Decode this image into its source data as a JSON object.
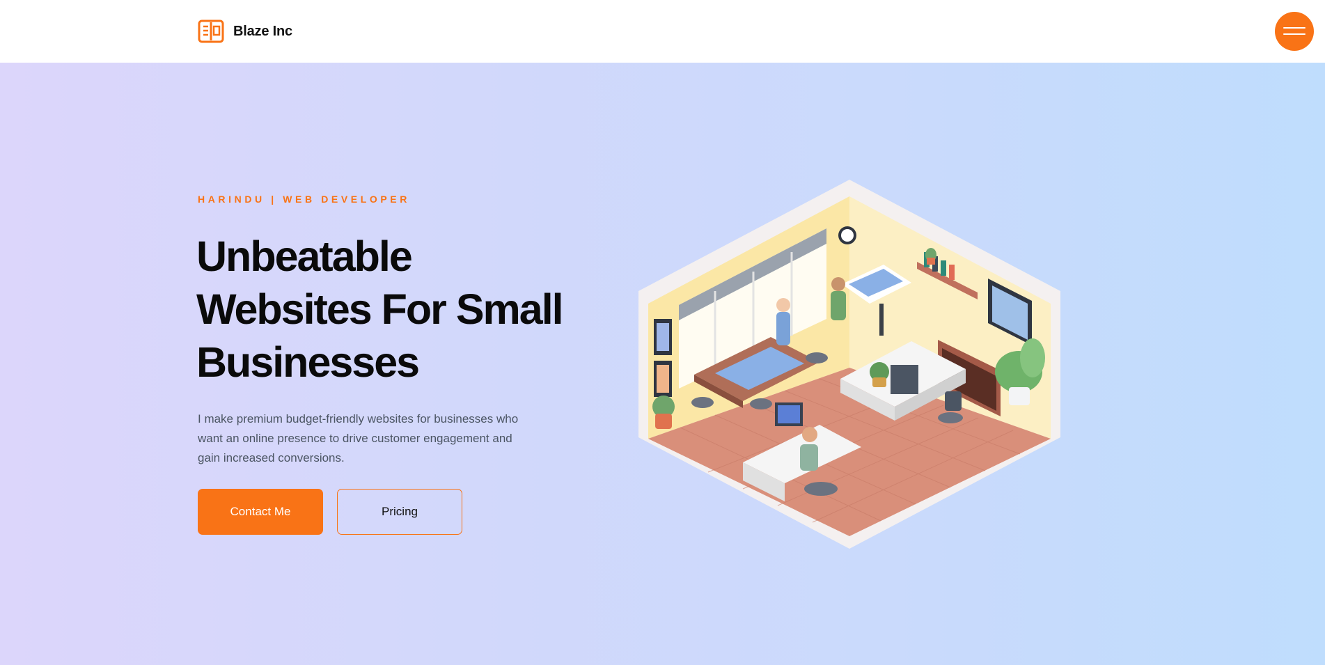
{
  "header": {
    "brand_name": "Blaze Inc",
    "logo_icon": "book-logo-icon",
    "menu_icon": "hamburger-menu-icon"
  },
  "hero": {
    "eyebrow": "HARINDU | WEB DEVELOPER",
    "headline_lines": [
      "Unbeatable",
      "Websites For Small",
      "Businesses"
    ],
    "description_lines": [
      "I make premium budget-friendly websites for businesses who",
      "want an online presence to drive customer engagement and",
      "gain increased conversions."
    ],
    "primary_button": "Contact Me",
    "secondary_button": "Pricing",
    "illustration": "isometric-office-illustration"
  },
  "colors": {
    "accent": "#f97316",
    "text_dark": "#0a0a0a",
    "text_muted": "#4b5563",
    "hero_gradient_start": "#dcd6fb",
    "hero_gradient_end": "#bfddfd"
  }
}
